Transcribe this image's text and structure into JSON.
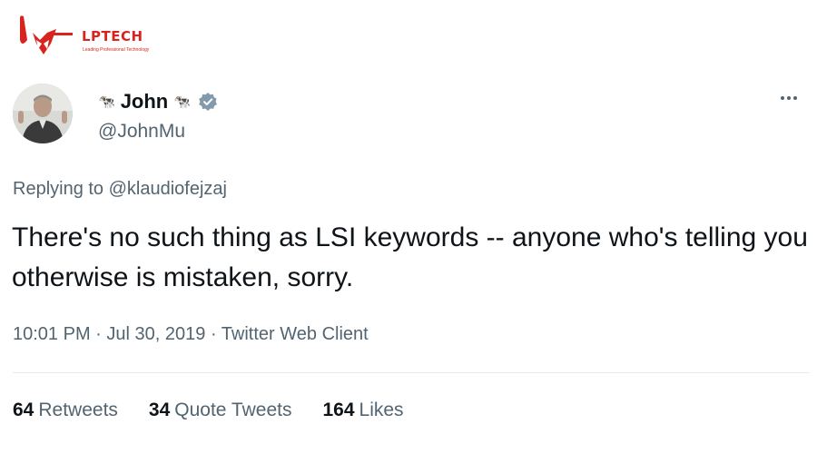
{
  "watermark": {
    "name": "LPTECH",
    "tagline": "Leading Professional Technology",
    "color": "#d8231f"
  },
  "author": {
    "name": "John",
    "name_emoji": "🐄",
    "handle": "@JohnMu",
    "verified": true
  },
  "reply": {
    "prefix": "Replying to",
    "mention": "@klaudiofejzaj"
  },
  "tweet": {
    "text": "There's no such thing as LSI keywords -- anyone who's telling you otherwise is mistaken, sorry."
  },
  "meta": {
    "time": "10:01 PM",
    "separator": "·",
    "date": "Jul 30, 2019",
    "source": "Twitter Web Client"
  },
  "stats": {
    "retweets_count": "64",
    "retweets_label": "Retweets",
    "quotes_count": "34",
    "quotes_label": "Quote Tweets",
    "likes_count": "164",
    "likes_label": "Likes"
  },
  "colors": {
    "text_primary": "#0f1419",
    "text_secondary": "#536471",
    "divider": "#e6ecf0",
    "verified_badge": "#829aab"
  }
}
